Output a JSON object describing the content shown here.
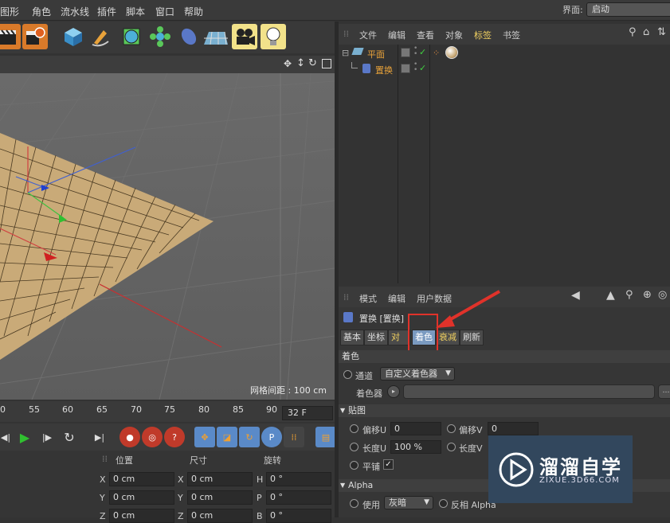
{
  "menu": {
    "items": [
      "图形",
      "角色",
      "流水线",
      "插件",
      "脚本",
      "窗口",
      "帮助"
    ]
  },
  "interface": {
    "label": "界面:",
    "value": "启动"
  },
  "viewport": {
    "grid_spacing": "网格间距 : 100 cm"
  },
  "timeline": {
    "ticks": [
      "0",
      "55",
      "60",
      "65",
      "70",
      "75",
      "80",
      "85",
      "90"
    ],
    "frame": "32 F"
  },
  "coords": {
    "headers": {
      "position": "位置",
      "size": "尺寸",
      "rotation": "旋转"
    },
    "rows": [
      {
        "axis": "X",
        "pos": "0 cm",
        "saxis": "X",
        "size": "0 cm",
        "raxis": "H",
        "rot": "0 °"
      },
      {
        "axis": "Y",
        "pos": "0 cm",
        "saxis": "Y",
        "size": "0 cm",
        "raxis": "P",
        "rot": "0 °"
      },
      {
        "axis": "Z",
        "pos": "0 cm",
        "saxis": "Z",
        "size": "0 cm",
        "raxis": "B",
        "rot": "0 °"
      }
    ]
  },
  "object_manager": {
    "menu": [
      "文件",
      "编辑",
      "查看",
      "对象",
      "标签",
      "书签"
    ],
    "objects": [
      {
        "name": "平面",
        "color": "#e8a23a"
      },
      {
        "name": "置换",
        "color": "#e8a23a"
      }
    ]
  },
  "attribute_manager": {
    "menu": [
      "模式",
      "编辑",
      "用户数据"
    ],
    "title": "置换 [置换]",
    "tabs": [
      "基本",
      "坐标",
      "对象",
      "着色",
      "衰减",
      "刷新"
    ],
    "active_tab": "着色",
    "section_shading": "着色",
    "channel_label": "通道",
    "channel_value": "自定义着色器",
    "shader_label": "着色器",
    "section_texture": "贴图",
    "offset_u_label": "偏移U",
    "offset_u": "0",
    "offset_v_label": "偏移V",
    "offset_v": "0",
    "length_u_label": "长度U",
    "length_u": "100 %",
    "length_v_label": "长度V",
    "tile_label": "平铺",
    "section_alpha": "Alpha",
    "use_label": "使用",
    "use_value": "灰暗",
    "invert_alpha_label": "反相 Alpha"
  },
  "watermark": {
    "title": "溜溜自学",
    "url": "ZIXUE.3D66.COM"
  },
  "colors": {
    "accent": "#f2e28a",
    "highlight_box": "#e0322a",
    "tag_active": "#f0d060"
  }
}
